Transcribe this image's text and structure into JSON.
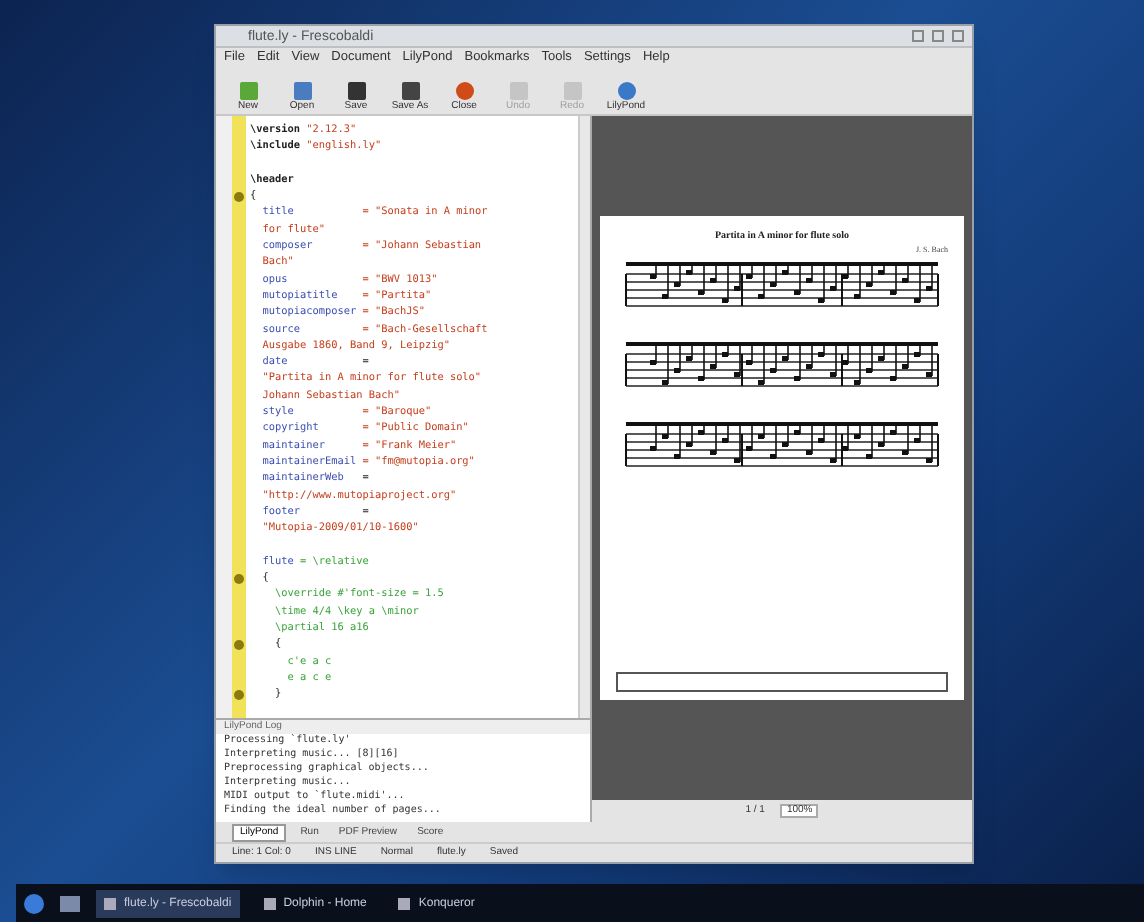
{
  "window": {
    "title": "flute.ly - Frescobaldi"
  },
  "menu": [
    "File",
    "Edit",
    "View",
    "Document",
    "LilyPond",
    "Bookmarks",
    "Tools",
    "Settings",
    "Help"
  ],
  "toolbar": [
    {
      "label": "New",
      "kind": "new",
      "disabled": false
    },
    {
      "label": "Open",
      "kind": "open",
      "disabled": false
    },
    {
      "label": "Save",
      "kind": "save",
      "disabled": false
    },
    {
      "label": "Save As",
      "kind": "saveas",
      "disabled": false
    },
    {
      "label": "Close",
      "kind": "close",
      "disabled": false
    },
    {
      "label": "Undo",
      "kind": "undo",
      "disabled": true
    },
    {
      "label": "Redo",
      "kind": "redo",
      "disabled": true
    },
    {
      "label": "LilyPond",
      "kind": "run",
      "disabled": false
    }
  ],
  "editor": {
    "lines": [
      {
        "fold": false,
        "segments": [
          {
            "kind": "keyword",
            "text": "\\version"
          },
          {
            "kind": "string",
            "text": " \"2.12.3\""
          }
        ]
      },
      {
        "fold": false,
        "segments": [
          {
            "kind": "keyword",
            "text": "\\include"
          },
          {
            "kind": "string",
            "text": " \"english.ly\""
          }
        ]
      },
      {
        "fold": false
      },
      {
        "fold": false,
        "segments": [
          {
            "kind": "keyword",
            "text": "\\header"
          }
        ]
      },
      {
        "fold": true,
        "segments": [
          {
            "kind": "plain",
            "text": "{"
          }
        ]
      },
      {
        "fold": false,
        "segments": [
          {
            "kind": "command",
            "text": "  title"
          },
          {
            "kind": "string",
            "text": "           = \"Sonata in A minor"
          }
        ]
      },
      {
        "fold": false,
        "segments": [
          {
            "kind": "string",
            "text": "  for flute\""
          }
        ]
      },
      {
        "fold": false,
        "segments": [
          {
            "kind": "command",
            "text": "  composer"
          },
          {
            "kind": "string",
            "text": "        = \"Johann Sebastian"
          }
        ]
      },
      {
        "fold": false,
        "segments": [
          {
            "kind": "string",
            "text": "  Bach\""
          }
        ]
      },
      {
        "fold": false,
        "segments": [
          {
            "kind": "command",
            "text": "  opus"
          },
          {
            "kind": "string",
            "text": "            = \"BWV 1013\""
          }
        ]
      },
      {
        "fold": false,
        "segments": [
          {
            "kind": "command",
            "text": "  mutopiatitle"
          },
          {
            "kind": "string",
            "text": "    = \"Partita\""
          }
        ]
      },
      {
        "fold": false,
        "segments": [
          {
            "kind": "command",
            "text": "  mutopiacomposer"
          },
          {
            "kind": "string",
            "text": " = \"BachJS\""
          }
        ]
      },
      {
        "fold": false,
        "segments": [
          {
            "kind": "command",
            "text": "  source"
          },
          {
            "kind": "string",
            "text": "          = \"Bach-Gesellschaft"
          }
        ]
      },
      {
        "fold": false,
        "segments": [
          {
            "kind": "string",
            "text": "  Ausgabe 1860, Band 9, Leipzig\""
          }
        ]
      },
      {
        "fold": false,
        "segments": [
          {
            "kind": "command",
            "text": "  date"
          },
          {
            "kind": "plain",
            "text": "            ="
          }
        ]
      },
      {
        "fold": false,
        "segments": [
          {
            "kind": "string",
            "text": "  \"Partita in A minor for flute solo\""
          }
        ]
      },
      {
        "fold": false,
        "segments": [
          {
            "kind": "string",
            "text": "  Johann Sebastian Bach\""
          }
        ]
      },
      {
        "fold": false,
        "segments": [
          {
            "kind": "command",
            "text": "  style"
          },
          {
            "kind": "string",
            "text": "           = \"Baroque\""
          }
        ]
      },
      {
        "fold": false,
        "segments": [
          {
            "kind": "command",
            "text": "  copyright"
          },
          {
            "kind": "string",
            "text": "       = \"Public Domain\""
          }
        ]
      },
      {
        "fold": false,
        "segments": [
          {
            "kind": "command",
            "text": "  maintainer"
          },
          {
            "kind": "string",
            "text": "      = \"Frank Meier\""
          }
        ]
      },
      {
        "fold": false,
        "segments": [
          {
            "kind": "command",
            "text": "  maintainerEmail"
          },
          {
            "kind": "string",
            "text": " = \"fm@mutopia.org\""
          }
        ]
      },
      {
        "fold": false,
        "segments": [
          {
            "kind": "command",
            "text": "  maintainerWeb"
          },
          {
            "kind": "plain",
            "text": "   ="
          }
        ]
      },
      {
        "fold": false,
        "segments": [
          {
            "kind": "string",
            "text": "  \"http://www.mutopiaproject.org\""
          }
        ]
      },
      {
        "fold": false,
        "segments": [
          {
            "kind": "command",
            "text": "  footer"
          },
          {
            "kind": "plain",
            "text": "          ="
          }
        ]
      },
      {
        "fold": false,
        "segments": [
          {
            "kind": "string",
            "text": "  \"Mutopia-2009/01/10-1600\""
          }
        ]
      },
      {
        "fold": false
      },
      {
        "fold": false,
        "segments": [
          {
            "kind": "command",
            "text": "  flute"
          },
          {
            "kind": "green",
            "text": " = \\relative"
          }
        ]
      },
      {
        "fold": true,
        "segments": [
          {
            "kind": "plain",
            "text": "  {"
          }
        ]
      },
      {
        "fold": false,
        "segments": [
          {
            "kind": "green",
            "text": "    \\override #'font-size = 1.5"
          }
        ]
      },
      {
        "fold": false,
        "segments": [
          {
            "kind": "green",
            "text": "    \\time 4/4 \\key a \\minor"
          }
        ]
      },
      {
        "fold": false,
        "segments": [
          {
            "kind": "green",
            "text": "    \\partial 16 a16"
          }
        ]
      },
      {
        "fold": true,
        "segments": [
          {
            "kind": "plain",
            "text": "    {"
          }
        ]
      },
      {
        "fold": false,
        "segments": [
          {
            "kind": "green",
            "text": "      c'e a c"
          }
        ]
      },
      {
        "fold": false,
        "segments": [
          {
            "kind": "green",
            "text": "      e a c e"
          }
        ]
      },
      {
        "fold": true,
        "segments": [
          {
            "kind": "plain",
            "text": "    }"
          }
        ]
      }
    ]
  },
  "log": {
    "title": "LilyPond Log",
    "lines": [
      "Processing `flute.ly'",
      "Interpreting music... [8][16]",
      "Preprocessing graphical objects...",
      "Interpreting music...",
      "MIDI output to `flute.midi'...",
      "Finding the ideal number of pages..."
    ]
  },
  "panel_tabs": [
    {
      "label": "LilyPond",
      "selected": true
    },
    {
      "label": "Run",
      "selected": false
    },
    {
      "label": "PDF Preview",
      "selected": false
    },
    {
      "label": "Score",
      "selected": false
    }
  ],
  "preview": {
    "page_title": "Partita in A minor for flute solo",
    "composer": "J. S. Bach",
    "zoom": "100%",
    "page": "1 / 1"
  },
  "status_bar": [
    "Line: 1 Col: 0",
    "INS LINE",
    "Normal",
    "flute.ly",
    "Saved"
  ],
  "taskbar": {
    "items": [
      {
        "label": "flute.ly - Frescobaldi",
        "selected": true
      },
      {
        "label": "Dolphin - Home",
        "selected": false
      },
      {
        "label": "Konqueror",
        "selected": false
      }
    ]
  }
}
